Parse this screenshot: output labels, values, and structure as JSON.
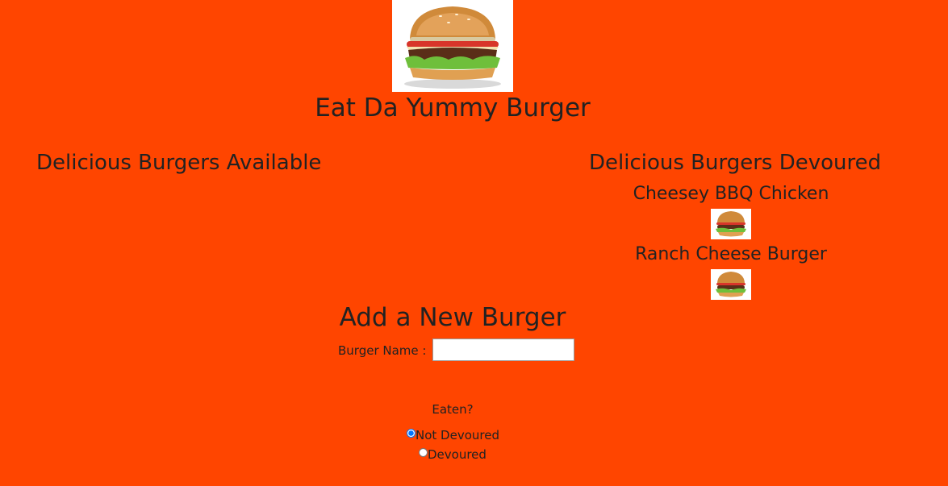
{
  "header": {
    "logo_icon": "burger-icon",
    "title": "Eat Da Yummy Burger"
  },
  "available": {
    "heading": "Delicious Burgers Available",
    "items": []
  },
  "devoured": {
    "heading": "Delicious Burgers Devoured",
    "items": [
      {
        "name": "Cheesey BBQ Chicken",
        "icon": "burger-icon"
      },
      {
        "name": "Ranch Cheese Burger",
        "icon": "burger-icon"
      }
    ]
  },
  "form": {
    "heading": "Add a New Burger",
    "name_label": "Burger Name :",
    "name_value": "",
    "eaten_label": "Eaten?",
    "options": [
      {
        "label": "Not Devoured",
        "checked": true
      },
      {
        "label": "Devoured",
        "checked": false
      }
    ]
  },
  "colors": {
    "background": "#ff4500",
    "text": "#222222"
  }
}
